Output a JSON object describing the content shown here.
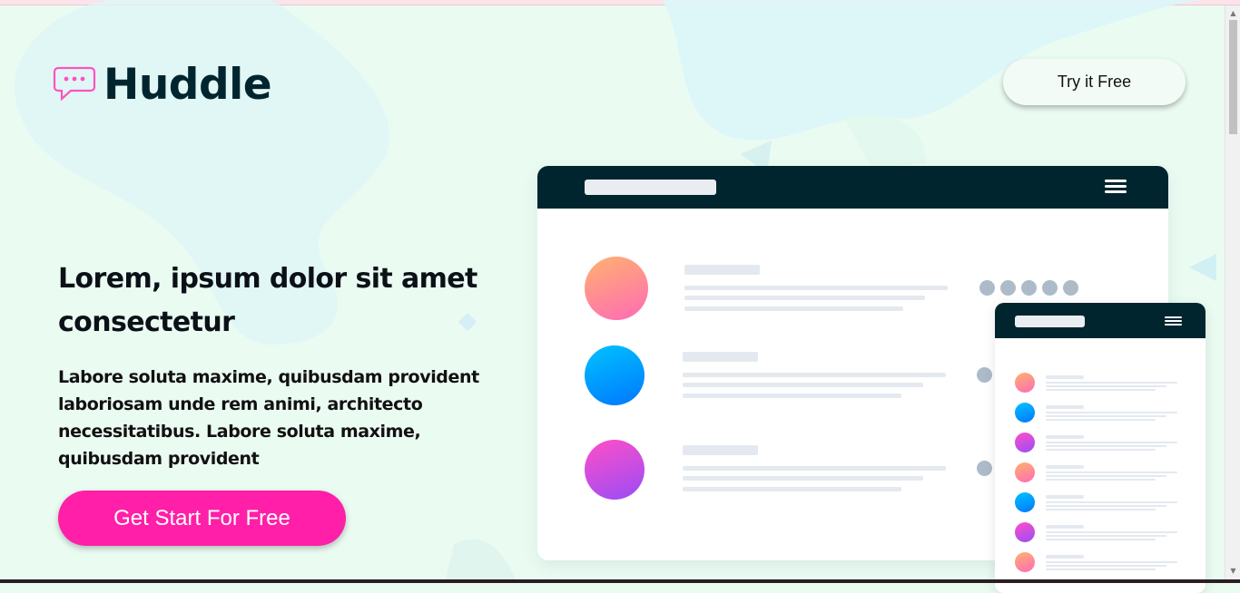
{
  "brand": {
    "name": "Huddle",
    "accent": "#ff1fa8",
    "dark": "#00252e"
  },
  "header": {
    "try_label": "Try it Free"
  },
  "hero": {
    "headline": "Lorem, ipsum dolor sit amet consectetur",
    "description": "Labore soluta maxime, quibusdam provident laboriosam unde rem animi, architecto necessitatibus. Labore soluta maxime, quibusdam provident",
    "cta_label": "Get Start For Free"
  },
  "icons": {
    "logo": "speech-bubble-icon",
    "menu": "hamburger-menu-icon",
    "scroll_up": "scroll-up-arrow",
    "scroll_down": "scroll-down-arrow"
  },
  "illustration": {
    "avatar_gradients": [
      [
        "#ffb16f",
        "#ff6bb5"
      ],
      [
        "#00c3ff",
        "#0077ff"
      ],
      [
        "#ff4fc7",
        "#9a4cf7"
      ]
    ]
  }
}
